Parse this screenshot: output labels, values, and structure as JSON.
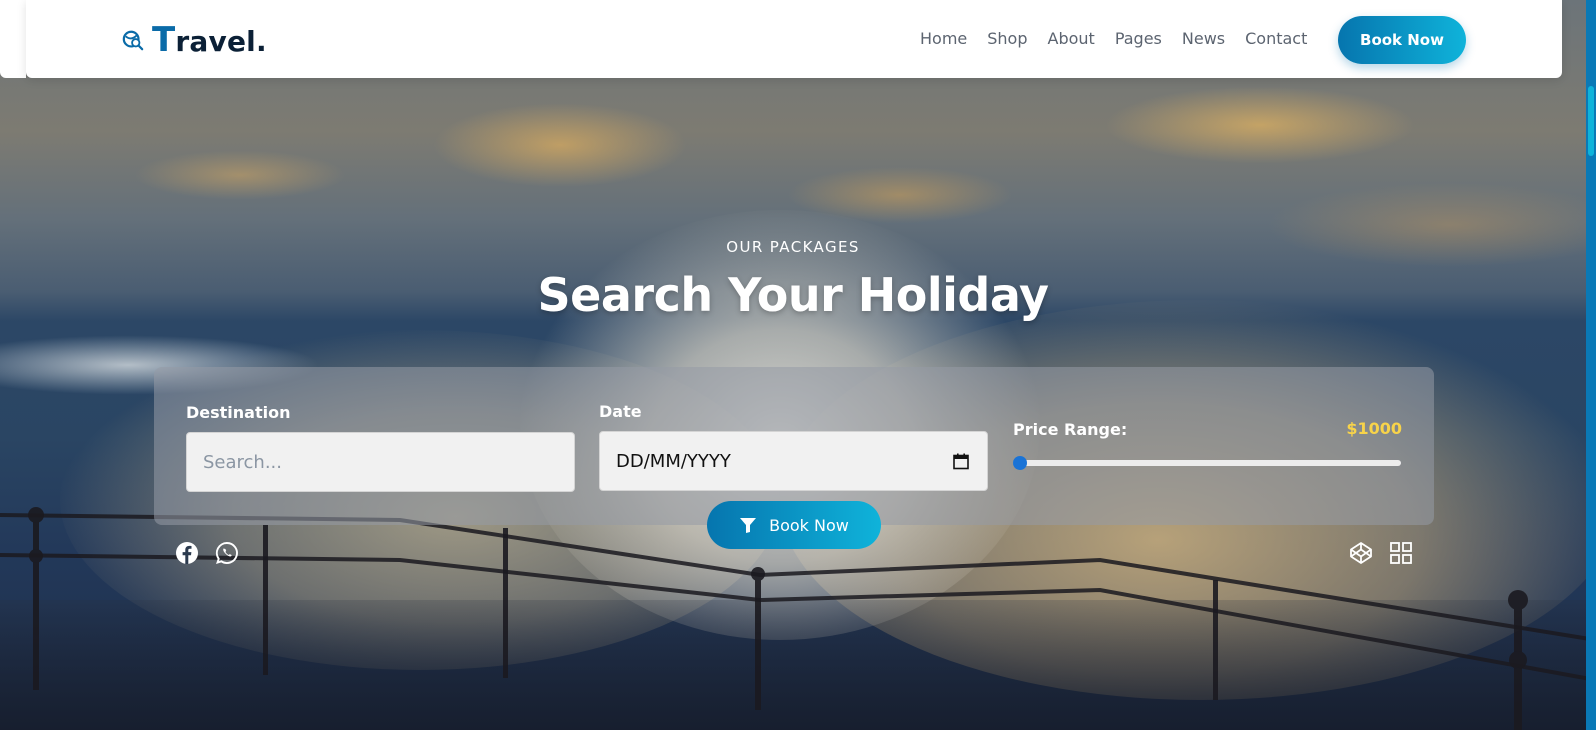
{
  "brand": {
    "logo_first_letter": "T",
    "logo_rest": "ravel.",
    "logo_icon": "globe-search-icon"
  },
  "nav": {
    "items": [
      {
        "label": "Home"
      },
      {
        "label": "Shop"
      },
      {
        "label": "About"
      },
      {
        "label": "Pages"
      },
      {
        "label": "News"
      },
      {
        "label": "Contact"
      }
    ],
    "cta_label": "Book Now"
  },
  "hero": {
    "eyebrow": "OUR PACKAGES",
    "title": "Search Your Holiday"
  },
  "search": {
    "destination_label": "Destination",
    "destination_placeholder": "Search...",
    "date_label": "Date",
    "date_value": "DD/MM/YYYY",
    "price_label": "Price Range:",
    "price_value": "$1000",
    "price_slider_level": 0,
    "submit_label": "Book Now",
    "submit_icon": "filter-icon"
  },
  "social": {
    "left": [
      "facebook-icon",
      "whatsapp-icon"
    ],
    "right": [
      "codepen-icon",
      "grid-icon"
    ]
  },
  "colors": {
    "accent_start": "#0675ae",
    "accent_end": "#0fb3da",
    "price_highlight": "#f7d34a",
    "logo_dark": "#0b2036",
    "slider_thumb": "#1a73d6"
  }
}
